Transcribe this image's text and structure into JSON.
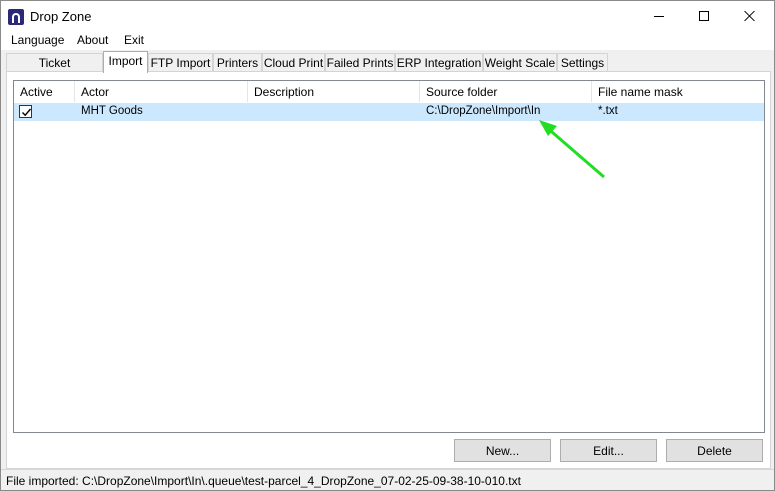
{
  "window": {
    "title": "Drop Zone"
  },
  "menu": [
    "Language",
    "About",
    "Exit"
  ],
  "tabs": [
    "Ticket Connection",
    "Import",
    "FTP Import",
    "Printers",
    "Cloud Print",
    "Failed Prints",
    "ERP Integration",
    "Weight Scale",
    "Settings"
  ],
  "active_tab": "Import",
  "table": {
    "columns": [
      "Active",
      "Actor",
      "Description",
      "Source folder",
      "File name mask"
    ],
    "rows": [
      {
        "active": true,
        "actor": "MHT Goods",
        "description": "",
        "source_folder": "C:\\DropZone\\Import\\In",
        "file_name_mask": "*.txt"
      }
    ]
  },
  "buttons": {
    "new": "New...",
    "edit": "Edit...",
    "delete": "Delete"
  },
  "status": "File imported: C:\\DropZone\\Import\\In\\.queue\\test-parcel_4_DropZone_07-02-25-09-38-10-010.txt",
  "colors": {
    "selection": "#cce8ff",
    "annotation_arrow": "#22dd22"
  }
}
